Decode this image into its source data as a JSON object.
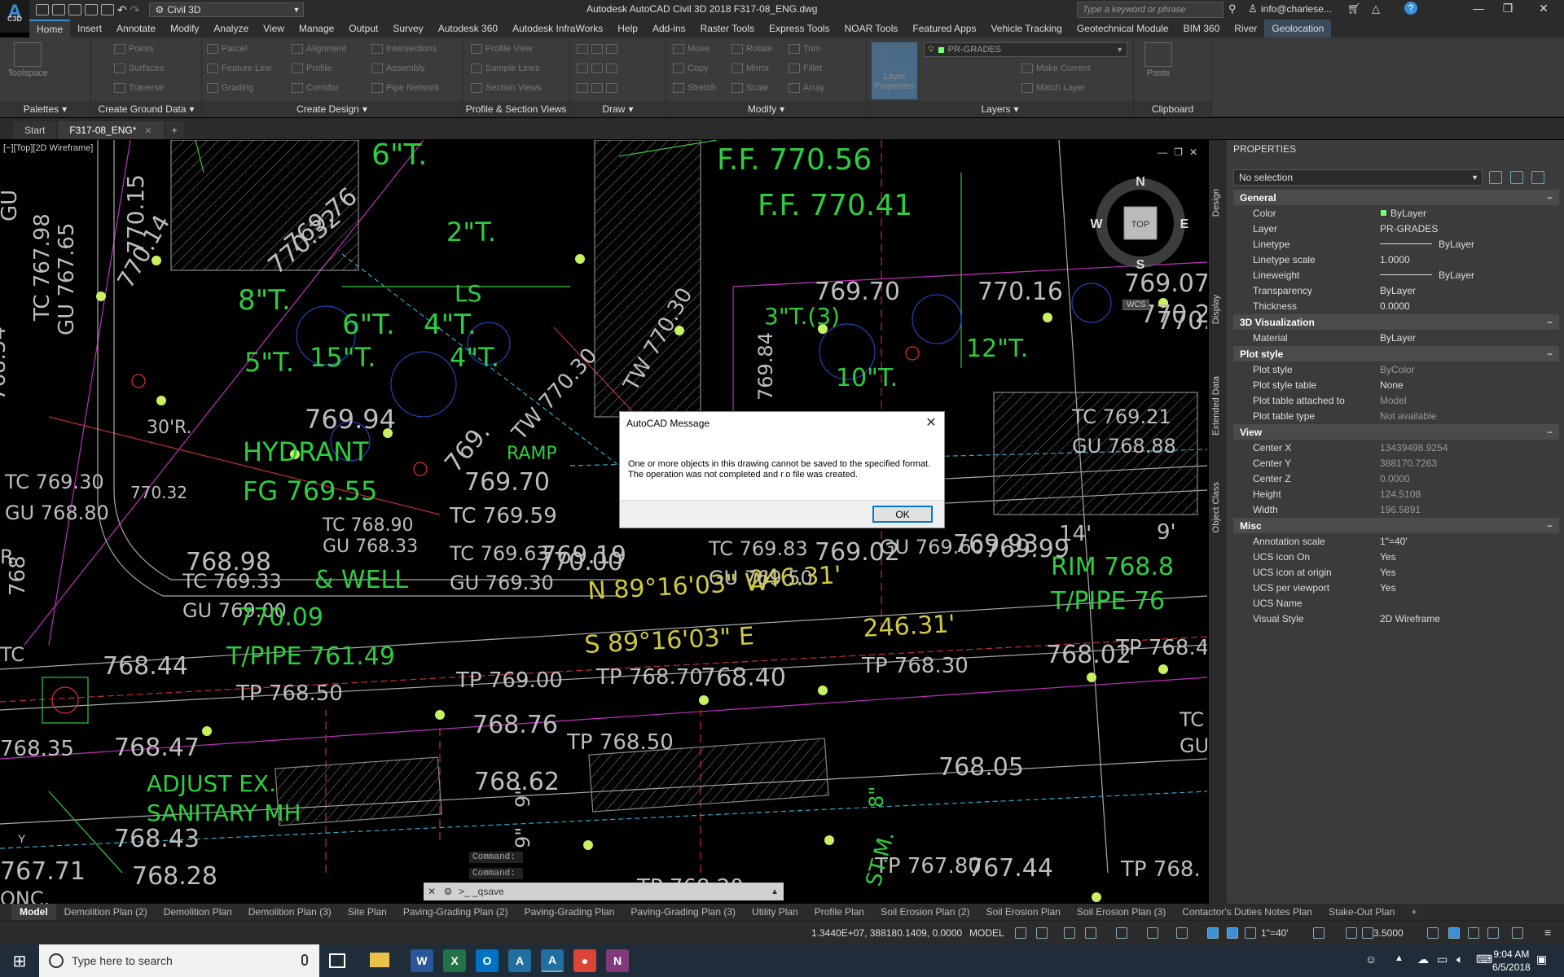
{
  "titlebar": {
    "logo_letter": "A",
    "logo_sub": "C3D",
    "workspace": "Civil 3D",
    "title": "Autodesk AutoCAD Civil 3D 2018    F317-08_ENG.dwg",
    "search_placeholder": "Type a keyword or phrase",
    "user": "info@charlese...",
    "minimize": "—",
    "maximize": "❐",
    "close": "✕"
  },
  "ribbon_tabs": [
    "Home",
    "Insert",
    "Annotate",
    "Modify",
    "Analyze",
    "View",
    "Manage",
    "Output",
    "Survey",
    "Autodesk 360",
    "Autodesk InfraWorks",
    "Help",
    "Add-ins",
    "Raster Tools",
    "Express Tools",
    "NOAR Tools",
    "Featured Apps",
    "Vehicle Tracking",
    "Geotechnical Module",
    "BIM 360",
    "River",
    "Geolocation"
  ],
  "ribbon": {
    "toolspace": "Toolspace",
    "points": "Points",
    "surfaces": "Surfaces",
    "traverse": "Traverse",
    "parcel": "Parcel",
    "feature_line": "Feature Line",
    "grading": "Grading",
    "alignment": "Alignment",
    "profile": "Profile",
    "corridor": "Corridor",
    "intersections": "Intersections",
    "assembly": "Assembly",
    "pipe_network": "Pipe Network",
    "profile_view": "Profile View",
    "sample_lines": "Sample Lines",
    "section_views": "Section Views",
    "move": "Move",
    "copy": "Copy",
    "stretch": "Stretch",
    "rotate": "Rotate",
    "mirror": "Mirror",
    "scale": "Scale",
    "trim": "Trim",
    "fillet": "Fillet",
    "array": "Array",
    "layer_properties": "Layer Properties",
    "layer_name": "PR-GRADES",
    "make_current": "Make Current",
    "match_layer": "Match Layer",
    "paste": "Paste",
    "panels": [
      "Palettes",
      "Create Ground Data",
      "Create Design",
      "Profile & Section Views",
      "Draw",
      "Modify",
      "Layers",
      "Clipboard"
    ]
  },
  "doc_tabs": {
    "start": "Start",
    "active": "F317-08_ENG*",
    "close": "✕",
    "plus": "+"
  },
  "canvas": {
    "view_label": "[−][Top][2D Wireframe]",
    "ctrl_min": "—",
    "ctrl_max": "❐",
    "ctrl_close": "✕",
    "compass": {
      "n": "N",
      "s": "S",
      "e": "E",
      "w": "W",
      "top": "TOP",
      "wcs": "WCS"
    },
    "texts": [
      "F.F. 770.56",
      "F.F. 770.41",
      "769.70",
      "770.16",
      "3\"T.(3)",
      "12\"T.",
      "10\"T.",
      "6\"T.",
      "8\"T.",
      "6\"T.",
      "4\"T.",
      "5\"T.",
      "15\"T.",
      "4\"T.",
      "LS",
      "2\"T.",
      "769.94",
      "HYDRANT",
      "FG 769.55",
      "30'R.",
      "RAMP",
      "769.70",
      "TC 769.59",
      "TC 769.30",
      "GU 768.80",
      "TC 769.33",
      "GU 769.00",
      "768.98",
      "& WELL",
      "770.09",
      "N 89°16'03\" W",
      "246.31'",
      "S 89°16'03\" E",
      "246.31'",
      "T/PIPE 761.49",
      "768.44",
      "TP 768.50",
      "TP 769.00",
      "TP 768.70",
      "768.40",
      "TP 768.30",
      "768.02",
      "TP 768.40",
      "768.76",
      "TP 768.50",
      "768.62",
      "768.47",
      "768.35",
      "ADJUST EX.",
      "SANITARY MH",
      "768.43",
      "768.28",
      "767.71",
      "768.05",
      "TP 767.80",
      "767.44",
      "TP 768.",
      "TP 768.20",
      "TC 769.21",
      "GU 768.88",
      "TC 769.63",
      "GU 769.30",
      "TC 769.83",
      "GU 769.50",
      "GU 769.60",
      "TC 768.90",
      "GU 768.33",
      "769.19",
      "769.02",
      "T/PIPE 76",
      "RIM 768.8",
      "14'",
      "9'",
      "TW 770.30",
      "TW 770.30",
      "770.32",
      "770.14",
      "770.15",
      "TC 767.98",
      "GU 767.65",
      "768.54",
      "769.84",
      "769.93",
      "769.99",
      "770.00",
      "ST.M.",
      "8\"",
      "9\"",
      "9\"",
      "TC",
      "GU",
      "ONC.",
      "768",
      "R.",
      "TC",
      "GU",
      "769.07",
      "770.2",
      "770.",
      "769.",
      "769.76",
      "770.32"
    ],
    "ucs_y": "Y"
  },
  "dialog": {
    "title": "AutoCAD Message",
    "close": "✕",
    "message": "One or more objects in this drawing cannot be saved to the specified format. The operation was not completed and no file was created.",
    "ok": "OK"
  },
  "command": {
    "history": [
      "Command:",
      "Command:"
    ],
    "current": "_qsave",
    "close": "✕",
    "prompt": ">_"
  },
  "layout_tabs": [
    "Model",
    "Demolition Plan (2)",
    "Demolition Plan",
    "Demolition Plan (3)",
    "Site Plan",
    "Paving-Grading Plan (2)",
    "Paving-Grading Plan",
    "Paving-Grading Plan (3)",
    "Utility Plan",
    "Profile Plan",
    "Soil Erosion Plan (2)",
    "Soil Erosion Plan",
    "Soil Erosion Plan (3)",
    "Contactor's Duties Notes Plan",
    "Stake-Out Plan",
    "+"
  ],
  "statusbar": {
    "coords": "1.3440E+07, 388180.1409, 0.0000",
    "model": "MODEL",
    "annoscale": "1\"=40'",
    "zoom": "3.5000"
  },
  "properties": {
    "title": "PROPERTIES",
    "selection": "No selection",
    "side_tabs": [
      "Design",
      "Display",
      "Extended Data",
      "Object Class"
    ],
    "sections": [
      {
        "name": "General",
        "rows": [
          {
            "k": "Color",
            "v": "ByLayer",
            "swatch": true
          },
          {
            "k": "Layer",
            "v": "PR-GRADES"
          },
          {
            "k": "Linetype",
            "v": "ByLayer",
            "line": true
          },
          {
            "k": "Linetype scale",
            "v": "1.0000"
          },
          {
            "k": "Lineweight",
            "v": "ByLayer",
            "line": true
          },
          {
            "k": "Transparency",
            "v": "ByLayer"
          },
          {
            "k": "Thickness",
            "v": "0.0000"
          }
        ]
      },
      {
        "name": "3D Visualization",
        "rows": [
          {
            "k": "Material",
            "v": "ByLayer"
          }
        ]
      },
      {
        "name": "Plot style",
        "rows": [
          {
            "k": "Plot style",
            "v": "ByColor",
            "dim": true
          },
          {
            "k": "Plot style table",
            "v": "None"
          },
          {
            "k": "Plot table attached to",
            "v": "Model",
            "dim": true
          },
          {
            "k": "Plot table type",
            "v": "Not available",
            "dim": true
          }
        ]
      },
      {
        "name": "View",
        "rows": [
          {
            "k": "Center X",
            "v": "13439498.9254",
            "dim": true
          },
          {
            "k": "Center Y",
            "v": "388170.7263",
            "dim": true
          },
          {
            "k": "Center Z",
            "v": "0.0000",
            "dim": true
          },
          {
            "k": "Height",
            "v": "124.5108",
            "dim": true
          },
          {
            "k": "Width",
            "v": "196.5891",
            "dim": true
          }
        ]
      },
      {
        "name": "Misc",
        "rows": [
          {
            "k": "Annotation scale",
            "v": "1\"=40'"
          },
          {
            "k": "UCS icon On",
            "v": "Yes"
          },
          {
            "k": "UCS icon at origin",
            "v": "Yes"
          },
          {
            "k": "UCS per viewport",
            "v": "Yes"
          },
          {
            "k": "UCS Name",
            "v": ""
          },
          {
            "k": "Visual Style",
            "v": "2D Wireframe"
          }
        ]
      }
    ],
    "section_min": "−"
  },
  "taskbar": {
    "search_placeholder": "Type here to search",
    "time": "9:04 AM",
    "date": "6/5/2018",
    "apps": [
      {
        "name": "word",
        "letter": "W",
        "color": "#2b579a"
      },
      {
        "name": "excel",
        "letter": "X",
        "color": "#217346"
      },
      {
        "name": "outlook",
        "letter": "O",
        "color": "#0072c6"
      },
      {
        "name": "autocad",
        "letter": "A",
        "color": "#1f6f9f"
      },
      {
        "name": "civil3d",
        "letter": "A",
        "color": "#1f6f9f"
      },
      {
        "name": "chrome",
        "letter": "●",
        "color": "#db4437"
      },
      {
        "name": "onenote",
        "letter": "N",
        "color": "#80397b"
      }
    ]
  },
  "colors": {
    "accent": "#3b8fd9",
    "green_text": "#2ecc40",
    "yellow_text": "#d0c840",
    "grey_text": "#bdbdbd",
    "magenta": "#c030c0",
    "red": "#e03030",
    "node": "#c8f060"
  }
}
